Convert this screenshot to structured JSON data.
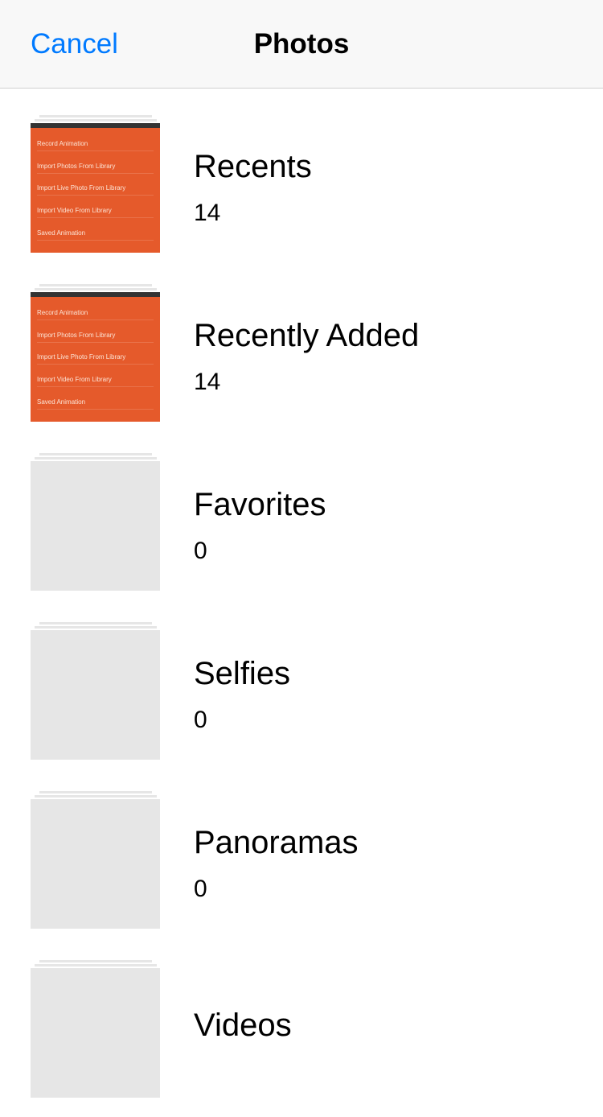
{
  "header": {
    "cancel_label": "Cancel",
    "title": "Photos"
  },
  "albums": [
    {
      "name": "Recents",
      "count": "14",
      "thumb_type": "orange"
    },
    {
      "name": "Recently Added",
      "count": "14",
      "thumb_type": "orange"
    },
    {
      "name": "Favorites",
      "count": "0",
      "thumb_type": "empty"
    },
    {
      "name": "Selfies",
      "count": "0",
      "thumb_type": "empty"
    },
    {
      "name": "Panoramas",
      "count": "0",
      "thumb_type": "empty"
    },
    {
      "name": "Videos",
      "count": "",
      "thumb_type": "empty"
    }
  ],
  "thumb_lines": [
    "Record Animation",
    "Import Photos From Library",
    "Import Live Photo From Library",
    "Import Video From Library",
    "Saved Animation"
  ]
}
